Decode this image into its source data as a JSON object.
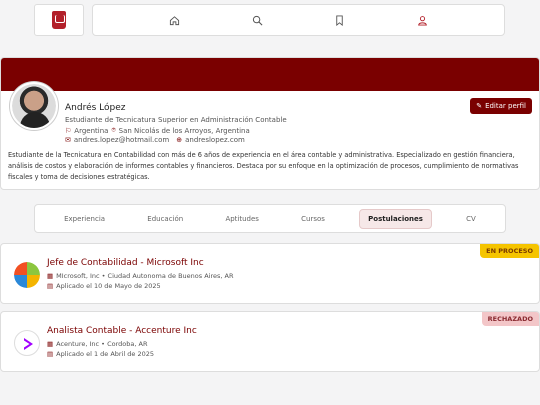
{
  "nav": {
    "icons": [
      "home-icon",
      "search-icon",
      "bookmark-icon",
      "user-icon"
    ]
  },
  "profile": {
    "name": "Andrés López",
    "title": "Estudiante de Tecnicatura Superior en Administración Contable",
    "country": "Argentina",
    "city": "San Nicolás de los Arroyos, Argentina",
    "email": "andres.lopez@hotmail.com",
    "website": "andreslopez.com",
    "edit_label": "Editar perfil",
    "bio": "Estudiante de la Tecnicatura en Contabilidad con más de 6 años de experiencia en el área contable y administrativa. Especializado en gestión financiera, análisis de costos y elaboración de informes contables y financieros. Destaca por su enfoque en la optimización de procesos, cumplimiento de normativas fiscales y toma de decisiones estratégicas."
  },
  "tabs": [
    {
      "label": "Experiencia",
      "active": false
    },
    {
      "label": "Educación",
      "active": false
    },
    {
      "label": "Aptitudes",
      "active": false
    },
    {
      "label": "Cursos",
      "active": false
    },
    {
      "label": "Postulaciones",
      "active": true
    },
    {
      "label": "CV",
      "active": false
    }
  ],
  "applications": [
    {
      "title": "Jefe de Contabilidad - Microsoft Inc",
      "company_location": "MIcrosoft, Inc • Ciudad Autonoma de Buenos Aires, AR",
      "applied": "Aplicado el 10 de Mayo de 2025",
      "status": "EN PROCESO",
      "status_color": "#f5c400"
    },
    {
      "title": "Analista Contable - Accenture Inc",
      "company_location": "Acenture, Inc • Cordoba, AR",
      "applied": "Aplicado el 1 de Abril de 2025",
      "status": "RECHAZADO",
      "status_color": "#f3c6c8"
    }
  ]
}
